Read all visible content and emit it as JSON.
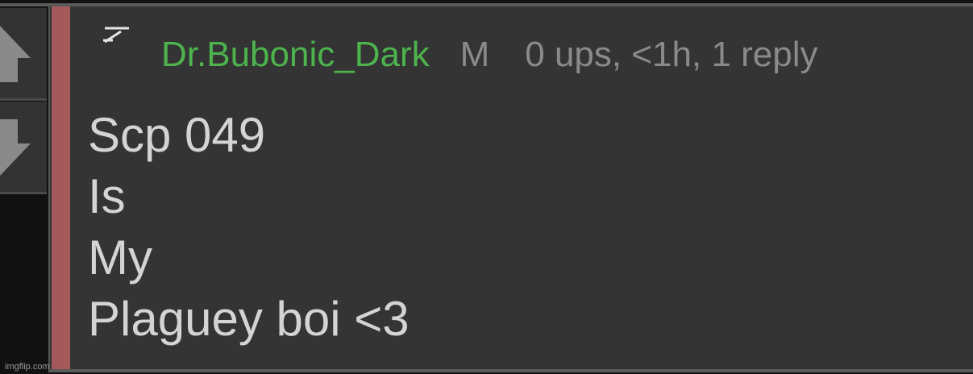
{
  "comment": {
    "username": "Dr.Bubonic_Dark",
    "gender": "M",
    "stats": "0 ups, <1h, 1 reply",
    "body_lines": [
      "Scp 049",
      "Is",
      "My",
      "Plaguey boi <3"
    ]
  },
  "icons": {
    "upvote": "arrow-up-icon",
    "downvote": "arrow-down-icon",
    "collapse": "collapse-icon"
  },
  "colors": {
    "username": "#4db34d",
    "depth_bar": "#a45a5a",
    "panel": "#343434",
    "meta_text": "#8a8a8a",
    "body_text": "#d4d4d4"
  },
  "watermark": "imgflip.com"
}
